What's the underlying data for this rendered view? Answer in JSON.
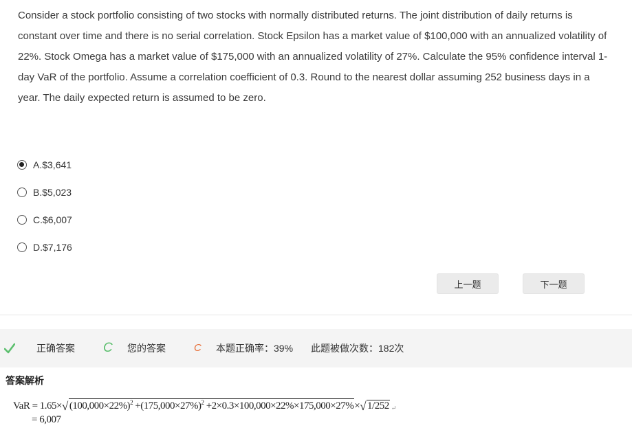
{
  "question": {
    "text": "Consider a stock portfolio consisting of two stocks with normally distributed returns. The joint distribution of daily returns is constant over time and there is no serial correlation. Stock Epsilon has a market value of $100,000 with an annualized volatility of 22%. Stock Omega has a market value of $175,000 with an annualized volatility of 27%. Calculate the 95% confidence interval 1-day VaR of the portfolio. Assume a correlation coefficient of 0.3. Round to the nearest dollar assuming 252 business days in a year. The daily expected return is assumed to be zero."
  },
  "options": [
    {
      "label": "A.$3,641",
      "selected": true
    },
    {
      "label": "B.$5,023",
      "selected": false
    },
    {
      "label": "C.$6,007",
      "selected": false
    },
    {
      "label": "D.$7,176",
      "selected": false
    }
  ],
  "nav": {
    "prev_label": "上一题",
    "next_label": "下一题"
  },
  "result": {
    "correct_answer_label": "正确答案",
    "correct_answer_value": "C",
    "your_answer_label": "您的答案",
    "your_answer_value": "C",
    "accuracy_text": "本题正确率：39%",
    "count_text": "此题被做次数：182次"
  },
  "analysis": {
    "title": "答案解析",
    "f_prefix": "VaR = 1.65×",
    "f_t1": "(100,000×22%)",
    "f_p1": "2",
    "f_t2": " +(175,000×27%)",
    "f_p2": "2",
    "f_t3": " +2×0.3×100,000×22%×175,000×27%",
    "f_mid": "×",
    "f_t4": "1/252",
    "result_line": "= 6,007"
  },
  "colors": {
    "check_green": "#5cbf6e",
    "answer_green": "#5cbf6e",
    "answer_orange": "#e8703a"
  }
}
